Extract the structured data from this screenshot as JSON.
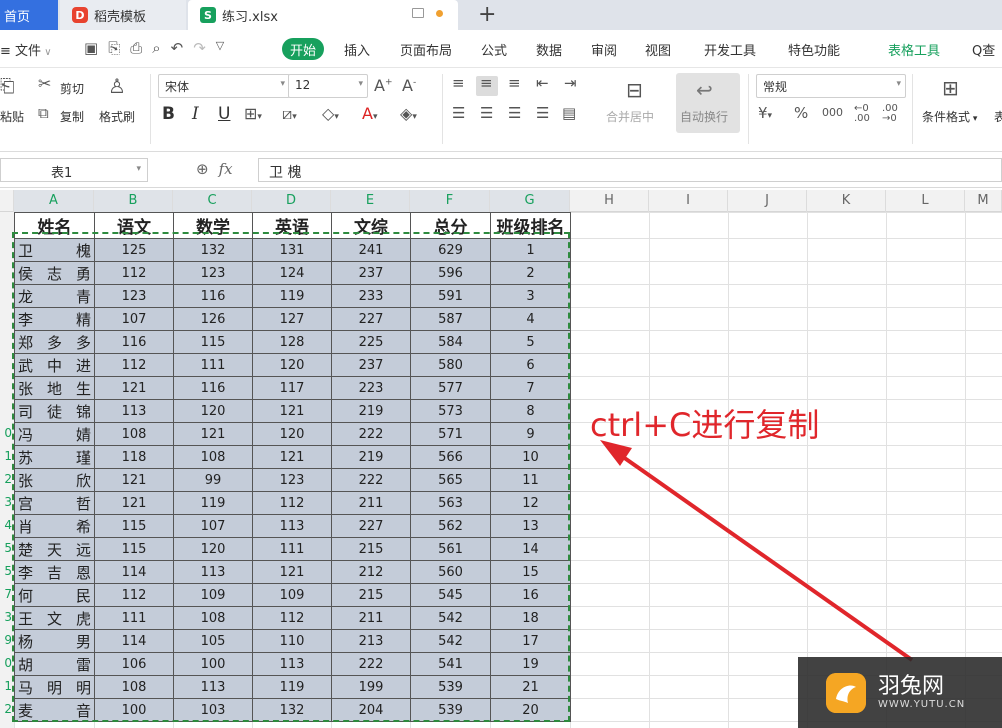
{
  "tabs": [
    {
      "label": "首页"
    },
    {
      "label": "稻壳模板"
    },
    {
      "label": "练习.xlsx"
    }
  ],
  "menu": {
    "file": "文件",
    "items": [
      "开始",
      "插入",
      "页面布局",
      "公式",
      "数据",
      "审阅",
      "视图",
      "开发工具",
      "特色功能",
      "表格工具"
    ],
    "search": "Q查"
  },
  "ribbon": {
    "paste": "粘贴",
    "cut": "剪切",
    "copy": "复制",
    "format_painter": "格式刷",
    "font_name": "宋体",
    "font_size": "12",
    "bold": "B",
    "italic": "I",
    "underline": "U",
    "merge_center": "合并居中",
    "wrap_text": "自动换行",
    "number_format": "常规",
    "conditional_format": "条件格式",
    "more": "表"
  },
  "formula_bar": {
    "name_box": "表1",
    "fx": "fx",
    "content": "卫 槐"
  },
  "columns": [
    "A",
    "B",
    "C",
    "D",
    "E",
    "F",
    "G",
    "H",
    "I",
    "J",
    "K",
    "L",
    "M"
  ],
  "row_numbers": [
    "",
    "",
    "",
    "",
    "",
    "",
    "",
    "",
    "",
    "0",
    "1",
    "2",
    "3",
    "4",
    "5",
    "5",
    "7",
    "3",
    "9",
    "0",
    "1",
    "2"
  ],
  "table": {
    "headers": [
      "姓名",
      "语文",
      "数学",
      "英语",
      "文综",
      "总分",
      "班级排名"
    ],
    "rows": [
      [
        "卫  槐",
        "125",
        "132",
        "131",
        "241",
        "629",
        "1"
      ],
      [
        "侯志勇",
        "112",
        "123",
        "124",
        "237",
        "596",
        "2"
      ],
      [
        "龙  青",
        "123",
        "116",
        "119",
        "233",
        "591",
        "3"
      ],
      [
        "李  精",
        "107",
        "126",
        "127",
        "227",
        "587",
        "4"
      ],
      [
        "郑多多",
        "116",
        "115",
        "128",
        "225",
        "584",
        "5"
      ],
      [
        "武中进",
        "112",
        "111",
        "120",
        "237",
        "580",
        "6"
      ],
      [
        "张地生",
        "121",
        "116",
        "117",
        "223",
        "577",
        "7"
      ],
      [
        "司徒锦",
        "113",
        "120",
        "121",
        "219",
        "573",
        "8"
      ],
      [
        "冯  婧",
        "108",
        "121",
        "120",
        "222",
        "571",
        "9"
      ],
      [
        "苏  瑾",
        "118",
        "108",
        "121",
        "219",
        "566",
        "10"
      ],
      [
        "张  欣",
        "121",
        "99",
        "123",
        "222",
        "565",
        "11"
      ],
      [
        "宫  哲",
        "121",
        "119",
        "112",
        "211",
        "563",
        "12"
      ],
      [
        "肖  希",
        "115",
        "107",
        "113",
        "227",
        "562",
        "13"
      ],
      [
        "楚天远",
        "115",
        "120",
        "111",
        "215",
        "561",
        "14"
      ],
      [
        "李吉恩",
        "114",
        "113",
        "121",
        "212",
        "560",
        "15"
      ],
      [
        "何  民",
        "112",
        "109",
        "109",
        "215",
        "545",
        "16"
      ],
      [
        "王文虎",
        "111",
        "108",
        "112",
        "211",
        "542",
        "18"
      ],
      [
        "杨  男",
        "114",
        "105",
        "110",
        "213",
        "542",
        "17"
      ],
      [
        "胡  雷",
        "106",
        "100",
        "113",
        "222",
        "541",
        "19"
      ],
      [
        "马明明",
        "108",
        "113",
        "119",
        "199",
        "539",
        "21"
      ],
      [
        "麦  音",
        "100",
        "103",
        "132",
        "204",
        "539",
        "20"
      ]
    ]
  },
  "annotation": "ctrl+C进行复制",
  "watermark": {
    "name": "羽兔网",
    "url": "WWW.YUTU.CN"
  },
  "colors": {
    "accent": "#17a05d",
    "selection": "#c4ccd9",
    "annotation": "#e0262b",
    "home_tab": "#3470e0"
  }
}
